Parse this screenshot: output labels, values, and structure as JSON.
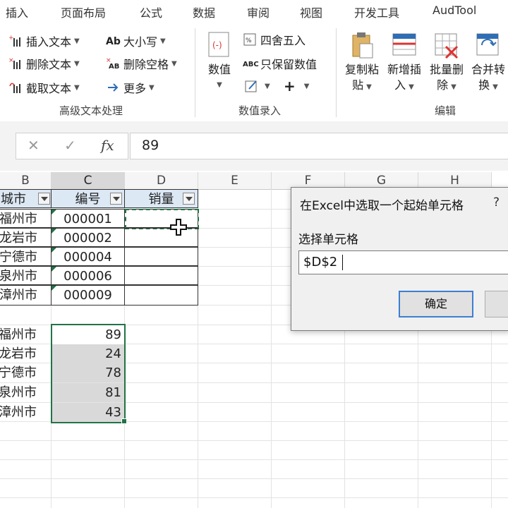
{
  "menu": {
    "tabs": [
      "插入",
      "页面布局",
      "公式",
      "数据",
      "审阅",
      "视图",
      "开发工具",
      "AudTool"
    ]
  },
  "ribbon": {
    "advanced_text": {
      "items": [
        "插入文本",
        "删除文本",
        "截取文本"
      ],
      "items2": [
        "大小写",
        "删除空格",
        "更多"
      ],
      "label": "高级文本处理"
    },
    "value_entry": {
      "big_button": "数值",
      "items": [
        "四舍五入",
        "只保留数值"
      ],
      "label": "数值录入"
    },
    "edit": {
      "buttons": [
        {
          "line1": "复制粘",
          "line2": "贴"
        },
        {
          "line1": "新增插",
          "line2": "入"
        },
        {
          "line1": "批量删",
          "line2": "除"
        },
        {
          "line1": "合并转",
          "line2": "换"
        }
      ],
      "label": "编辑"
    }
  },
  "formula_bar": {
    "cancel": "✕",
    "confirm": "✓",
    "fx": "fx",
    "value": "89"
  },
  "grid": {
    "columns": [
      "B",
      "C",
      "D",
      "E",
      "F",
      "G",
      "H"
    ],
    "headers": {
      "city": "城市",
      "code": "编号",
      "sales": "销量"
    },
    "table_rows": [
      {
        "city": "福州市",
        "code": "000001"
      },
      {
        "city": "龙岩市",
        "code": "000002"
      },
      {
        "city": "宁德市",
        "code": "000004"
      },
      {
        "city": "泉州市",
        "code": "000006"
      },
      {
        "city": "漳州市",
        "code": "000009"
      }
    ],
    "lower_rows": [
      {
        "city": "福州市",
        "value": "89"
      },
      {
        "city": "龙岩市",
        "value": "24"
      },
      {
        "city": "宁德市",
        "value": "78"
      },
      {
        "city": "泉州市",
        "value": "81"
      },
      {
        "city": "漳州市",
        "value": "43"
      }
    ]
  },
  "dialog": {
    "title": "在Excel中选取一个起始单元格",
    "help": "?",
    "label": "选择单元格",
    "input_value": "$D$2",
    "ok": "确定"
  },
  "colors": {
    "excel_green": "#217346",
    "selection_fill": "#d9d9d9",
    "header_fill": "#dde8f5"
  }
}
